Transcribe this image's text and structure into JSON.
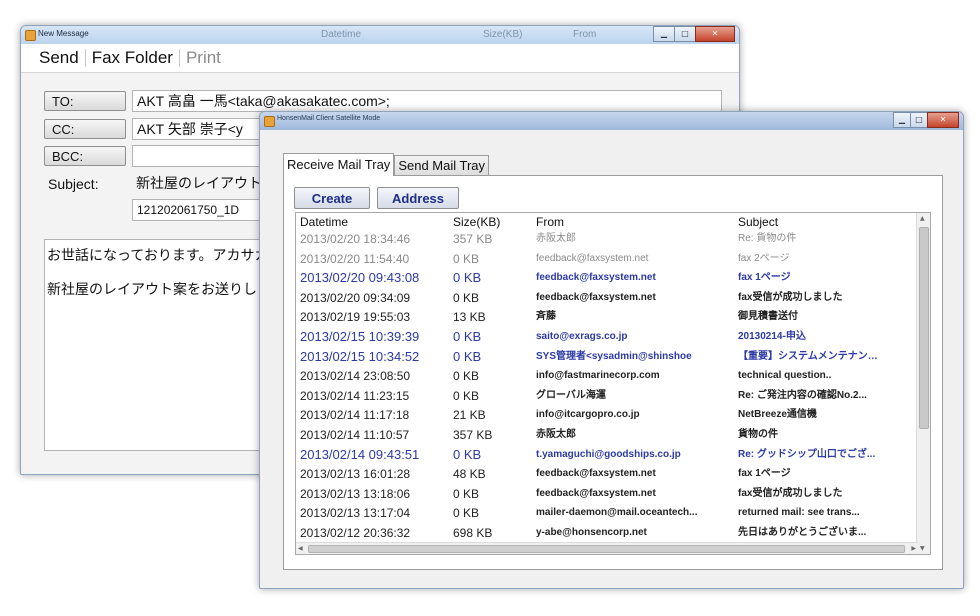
{
  "new_message": {
    "title": "New Message",
    "menu": {
      "send": "Send",
      "fax_folder": "Fax Folder",
      "print": "Print"
    },
    "fields": {
      "to_label": "TO:",
      "to_value": "AKT 高畠 一馬<taka@akasakatec.com>;",
      "cc_label": "CC:",
      "cc_value": "AKT 矢部 崇子<y",
      "bcc_label": "BCC:",
      "bcc_value": "",
      "subject_label": "Subject:",
      "subject_value": "新社屋のレイアウト",
      "attachment_value": "121202061750_1D"
    },
    "body_lines": [
      "お世話になっております。アカサカ",
      "新社屋のレイアウト案をお送りし"
    ],
    "faded_header": {
      "datetime": "Datetime",
      "size": "Size(KB)",
      "from": "From"
    }
  },
  "mail_client": {
    "title": "HonsenMail Client  Satellite Mode",
    "tabs": [
      "Receive Mail Tray",
      "Send Mail Tray"
    ],
    "active_tab": 0,
    "buttons": {
      "create": "Create",
      "address": "Address"
    },
    "columns": [
      "Datetime",
      "Size(KB)",
      "From",
      "Subject"
    ],
    "rows": [
      {
        "datetime": "2013/02/20 18:34:46",
        "size": "357 KB",
        "from": "赤阪太郎",
        "subject": "Re: 貨物の件",
        "style": "gray"
      },
      {
        "datetime": "2013/02/20 11:54:40",
        "size": "0 KB",
        "from": "feedback@faxsystem.net",
        "subject": "fax 2ページ",
        "style": "gray"
      },
      {
        "datetime": "2013/02/20 09:43:08",
        "size": "0 KB",
        "from": "feedback@faxsystem.net",
        "subject": "fax 1ページ",
        "style": "blue"
      },
      {
        "datetime": "2013/02/20 09:34:09",
        "size": "0 KB",
        "from": "feedback@faxsystem.net",
        "subject": "fax受信が成功しました",
        "style": "black"
      },
      {
        "datetime": "2013/02/19 19:55:03",
        "size": "13 KB",
        "from": "斉藤",
        "subject": "御見積書送付",
        "style": "black"
      },
      {
        "datetime": "2013/02/15 10:39:39",
        "size": "0 KB",
        "from": "saito@exrags.co.jp",
        "subject": "20130214-申込",
        "style": "blue"
      },
      {
        "datetime": "2013/02/15 10:34:52",
        "size": "0 KB",
        "from": "SYS管理者<sysadmin@shinshoe",
        "subject": "【重要】システムメンテナン…",
        "style": "blue"
      },
      {
        "datetime": "2013/02/14 23:08:50",
        "size": "0 KB",
        "from": "info@fastmarinecorp.com",
        "subject": "technical question..",
        "style": "black"
      },
      {
        "datetime": "2013/02/14 11:23:15",
        "size": "0 KB",
        "from": "グローバル海運",
        "subject": "Re: ご発注内容の確認No.2...",
        "style": "black"
      },
      {
        "datetime": "2013/02/14 11:17:18",
        "size": "21 KB",
        "from": "info@itcargopro.co.jp",
        "subject": "NetBreeze通信機",
        "style": "black"
      },
      {
        "datetime": "2013/02/14 11:10:57",
        "size": "357 KB",
        "from": "赤阪太郎",
        "subject": "貨物の件",
        "style": "black"
      },
      {
        "datetime": "2013/02/14 09:43:51",
        "size": "0 KB",
        "from": "t.yamaguchi@goodships.co.jp",
        "subject": "Re: グッドシップ山口でござ...",
        "style": "blue"
      },
      {
        "datetime": "2013/02/13 16:01:28",
        "size": "48 KB",
        "from": "feedback@faxsystem.net",
        "subject": "fax 1ページ",
        "style": "black"
      },
      {
        "datetime": "2013/02/13 13:18:06",
        "size": "0 KB",
        "from": "feedback@faxsystem.net",
        "subject": "fax受信が成功しました",
        "style": "black"
      },
      {
        "datetime": "2013/02/13 13:17:04",
        "size": "0 KB",
        "from": "mailer-daemon@mail.oceantech...",
        "subject": "returned mail: see trans...",
        "style": "black"
      },
      {
        "datetime": "2013/02/12 20:36:32",
        "size": "698 KB",
        "from": "y-abe@honsencorp.net",
        "subject": "先日はありがとうございま...",
        "style": "black"
      }
    ]
  }
}
